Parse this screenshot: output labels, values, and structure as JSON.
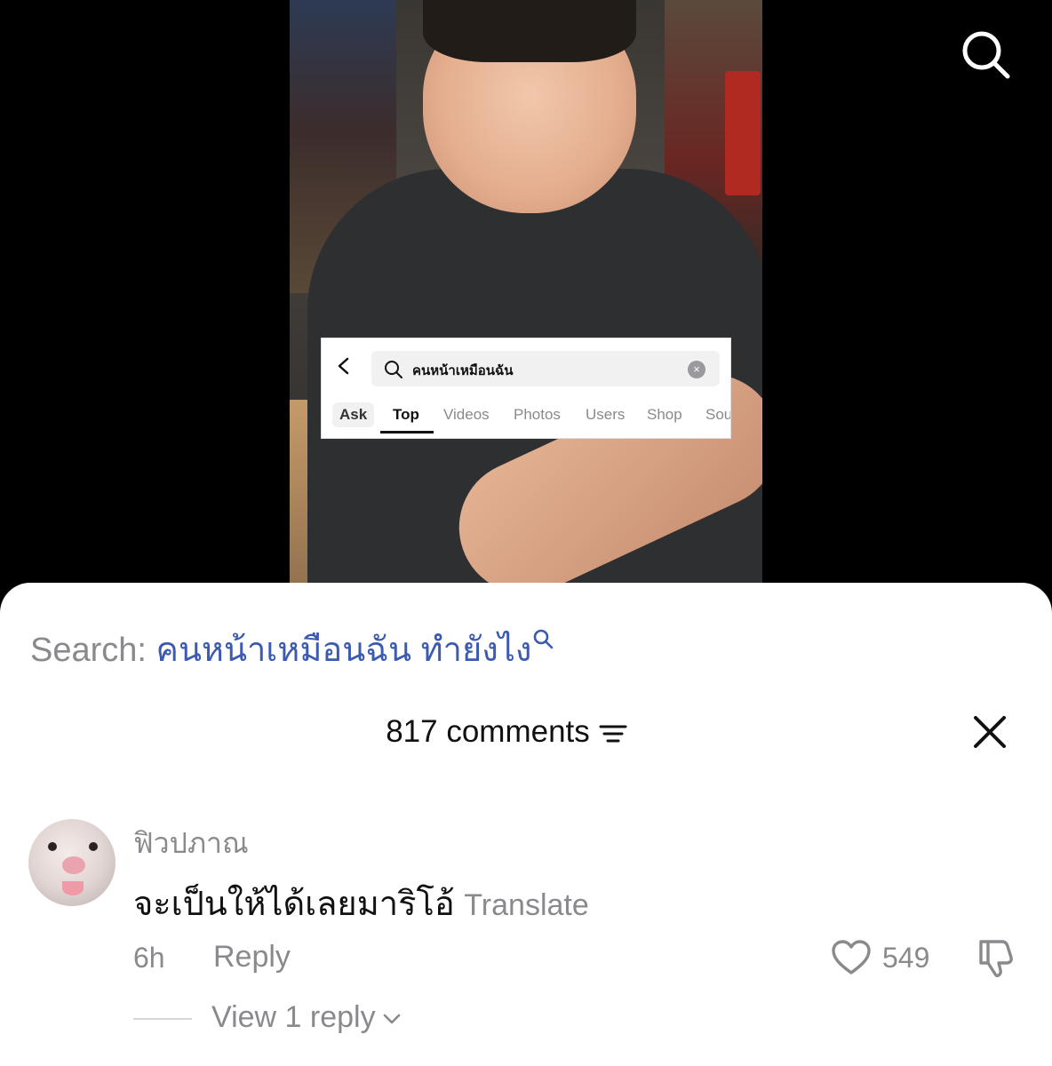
{
  "overlay": {
    "query": "คนหน้าเหมือนฉัน",
    "tabs": [
      "Ask",
      "Top",
      "Videos",
      "Photos",
      "Users",
      "Shop",
      "Sou"
    ],
    "active_tab": "Top"
  },
  "sheet": {
    "search_prefix": "Search:",
    "search_term": "คนหน้าเหมือนฉัน ทำยังไง",
    "comment_count": "817 comments"
  },
  "comment": {
    "username": "ฟิวปภาณ",
    "text": "จะเป็นให้ได้เลยมาริโอ้",
    "translate_label": "Translate",
    "time": "6h",
    "reply_label": "Reply",
    "likes": "549",
    "view_replies": "View 1 reply"
  },
  "icons": [
    "search-icon",
    "back-icon",
    "clear-icon",
    "filter-icon",
    "close-icon",
    "heart-icon",
    "dislike-icon",
    "chevron-down-icon"
  ]
}
